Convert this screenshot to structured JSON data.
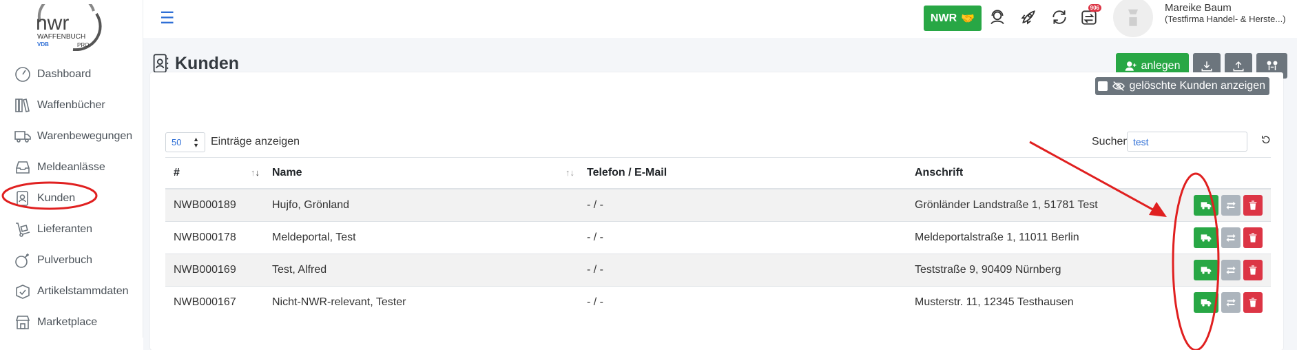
{
  "logo": {
    "text": "nwr",
    "subtitle": "WAFFENBUCH",
    "mark_left": "VDB",
    "mark_right": "PRO"
  },
  "sidebar": {
    "items": [
      {
        "label": "Dashboard",
        "icon": "dashboard-icon"
      },
      {
        "label": "Waffenbücher",
        "icon": "books-icon"
      },
      {
        "label": "Warenbewegungen",
        "icon": "truck-icon"
      },
      {
        "label": "Meldeanlässe",
        "icon": "inbox-icon"
      },
      {
        "label": "Kunden",
        "icon": "contact-icon"
      },
      {
        "label": "Lieferanten",
        "icon": "dolly-icon"
      },
      {
        "label": "Pulverbuch",
        "icon": "powder-icon"
      },
      {
        "label": "Artikelstammdaten",
        "icon": "box-check-icon"
      },
      {
        "label": "Marketplace",
        "icon": "store-icon"
      }
    ]
  },
  "topbar": {
    "nwr_button": "NWR",
    "badge_count": "906",
    "user_name": "Mareike Baum",
    "user_company": "(Testfirma Handel- & Herste...)"
  },
  "page": {
    "title": "Kunden",
    "add_button": "anlegen",
    "show_deleted_label": "gelöschte Kunden anzeigen",
    "length_value": "50",
    "length_label": "Einträge anzeigen",
    "search_label": "Suchen",
    "search_value": "test"
  },
  "table": {
    "headers": [
      "#",
      "Name",
      "Telefon / E-Mail",
      "Anschrift"
    ],
    "rows": [
      {
        "id": "NWB000189",
        "name": "Hujfo, Grönland",
        "contact": "- / -",
        "address": "Grönländer Landstraße 1, 51781 Test"
      },
      {
        "id": "NWB000178",
        "name": "Meldeportal, Test",
        "contact": "- / -",
        "address": "Meldeportalstraße 1, 11011 Berlin"
      },
      {
        "id": "NWB000169",
        "name": "Test, Alfred",
        "contact": "- / -",
        "address": "Teststraße 9, 90409 Nürnberg"
      },
      {
        "id": "NWB000167",
        "name": "Nicht-NWR-relevant, Tester",
        "contact": "- / -",
        "address": "Musterstr. 11, 12345 Testhausen"
      }
    ]
  },
  "colors": {
    "green": "#28a745",
    "grey": "#6c757d",
    "red": "#dc3545",
    "accent_blue": "#2f6fd6",
    "annotation_red": "#e02020"
  }
}
